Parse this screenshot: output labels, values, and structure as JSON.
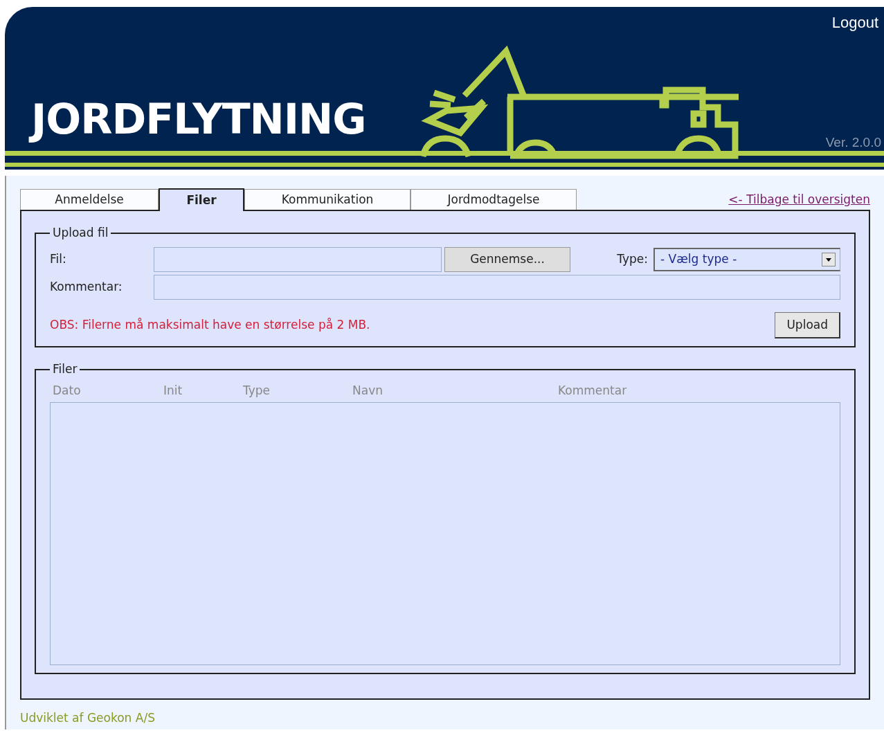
{
  "header": {
    "title": "JORDFLYTNING",
    "logout": "Logout",
    "version": "Ver. 2.0.0"
  },
  "tabs": [
    {
      "label": "Anmeldelse",
      "selected": false
    },
    {
      "label": "Filer",
      "selected": true
    },
    {
      "label": "Kommunikation",
      "selected": false
    },
    {
      "label": "Jordmodtagelse",
      "selected": false
    }
  ],
  "back_link": "<- Tilbage til oversigten",
  "upload": {
    "legend": "Upload fil",
    "file_label": "Fil:",
    "browse_button": "Gennemse...",
    "type_label": "Type:",
    "type_select": "- Vælg type -",
    "comment_label": "Kommentar:",
    "notice": "OBS: Filerne må maksimalt have en størrelse på 2 MB.",
    "upload_button": "Upload"
  },
  "files": {
    "legend": "Filer",
    "columns": [
      "Dato",
      "Init",
      "Type",
      "Navn",
      "Kommentar"
    ]
  },
  "footer": "Udviklet af Geokon A/S"
}
